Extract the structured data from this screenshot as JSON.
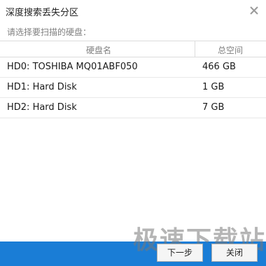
{
  "window": {
    "title": "深度搜索丢失分区",
    "close_icon": "close-icon"
  },
  "prompt": "请选择要扫描的硬盘：",
  "table": {
    "headers": {
      "name": "硬盘名",
      "size": "总空间"
    },
    "rows": [
      {
        "name": "HD0: TOSHIBA MQ01ABF050",
        "size": "466 GB"
      },
      {
        "name": "HD1: Hard Disk",
        "size": "1 GB"
      },
      {
        "name": "HD2: Hard Disk",
        "size": "7 GB"
      }
    ]
  },
  "footer": {
    "next_label": "下一步",
    "close_label": "关闭",
    "watermark": "极速下载站",
    "bar_color": "#1a7dd6"
  }
}
